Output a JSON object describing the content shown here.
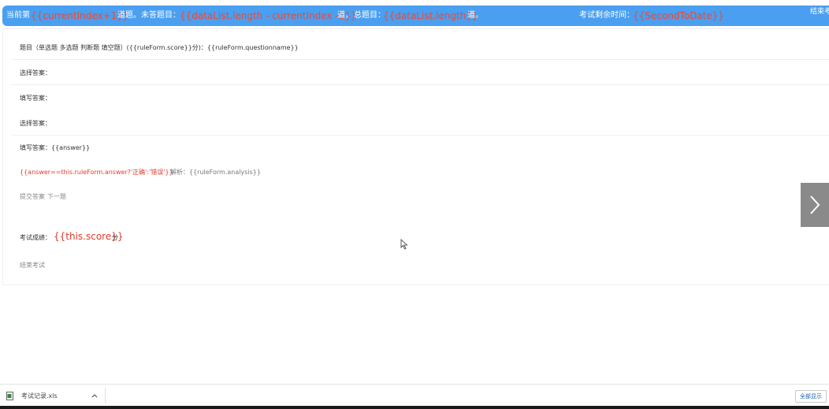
{
  "header": {
    "current_label": "当前第",
    "current_value": "{{currentIndex+1}}",
    "current_unit": "道题。",
    "unanswered_label": "未答题目：",
    "unanswered_value": "{{dataList.length - currentIndex -1}}",
    "unanswered_unit": "道，",
    "total_label": "总题目：",
    "total_value": "{{dataList.length}}",
    "total_unit": "道。",
    "time_label": "考试剩余时间：",
    "time_value": "{{SecondToDate}}",
    "end_label": "结束考"
  },
  "question": {
    "title": "题目（单选题 多选题 判断题 填空题）({{ruleForm.score}}分)：{{ruleForm.questionname}}",
    "select_answer_1": "选择答案：",
    "fill_answer_1": "填写答案：",
    "select_answer_2": "选择答案：",
    "fill_answer_2": "填写答案：{{answer}}",
    "result": "{{answer==this.ruleForm.answer?'正确':'错误'}}",
    "analysis": "解析：{{ruleForm.analysis}}",
    "submit_label": "提交答案",
    "next_label": "下一题",
    "score_label": "考试成绩：",
    "score_value": "{{this.score}}",
    "score_unit": "分",
    "end_exam": "结束考试"
  },
  "downloads": {
    "file_name": "考试记录.xls",
    "show_all": "全部显示"
  },
  "icons": {
    "next": "chevron-right-icon",
    "file": "file-icon",
    "expand": "chevron-up-icon",
    "cursor": "mouse-cursor-icon"
  },
  "colors": {
    "header_bg": "#4a9ff0",
    "accent_red": "#f0492f"
  }
}
